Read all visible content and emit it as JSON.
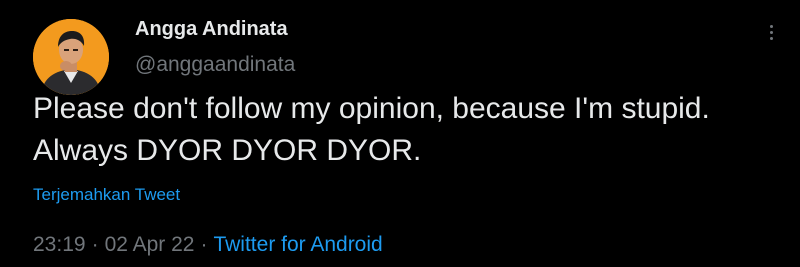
{
  "author": {
    "display_name": "Angga Andinata",
    "handle": "@anggaandinata",
    "avatar_icon": "user-avatar"
  },
  "tweet": {
    "text": "Please don't follow my opinion, because I'm stupid. Always DYOR DYOR DYOR."
  },
  "actions": {
    "translate_label": "Terjemahkan Tweet",
    "more_icon": "more-vertical-icon"
  },
  "meta": {
    "time": "23:19",
    "separator": "·",
    "date": "02 Apr 22",
    "source": "Twitter for Android"
  },
  "colors": {
    "background": "#000000",
    "text_primary": "#e7e9ea",
    "text_secondary": "#71767b",
    "accent": "#1d9bf0",
    "avatar_bg": "#f39a1e"
  }
}
